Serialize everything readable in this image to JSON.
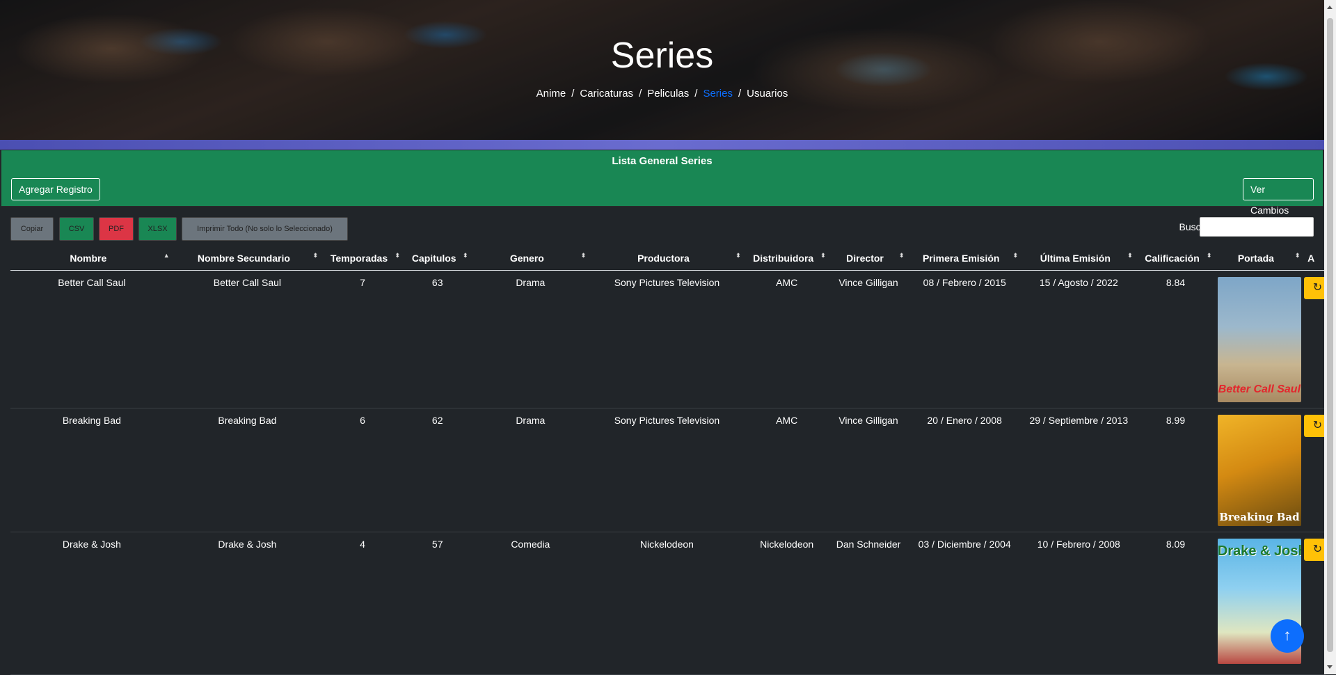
{
  "header": {
    "title": "Series",
    "breadcrumb": [
      {
        "label": "Anime",
        "active": false
      },
      {
        "label": "Caricaturas",
        "active": false
      },
      {
        "label": "Peliculas",
        "active": false
      },
      {
        "label": "Series",
        "active": true
      },
      {
        "label": "Usuarios",
        "active": false
      }
    ],
    "separator": "/"
  },
  "panel": {
    "title": "Lista General Series",
    "add_label": "Agregar Registro",
    "changes_label": "Ver Cambios"
  },
  "export": {
    "copy": "Copiar",
    "csv": "CSV",
    "pdf": "PDF",
    "xlsx": "XLSX",
    "print": "Imprimir Todo (No solo lo Seleccionado)"
  },
  "search": {
    "label": "Buscar:",
    "value": ""
  },
  "table": {
    "columns": [
      "Nombre",
      "Nombre Secundario",
      "Temporadas",
      "Capitulos",
      "Genero",
      "Productora",
      "Distribuidora",
      "Director",
      "Primera Emisión",
      "Última Emisión",
      "Calificación",
      "Portada",
      "A"
    ],
    "rows": [
      {
        "nombre": "Better Call Saul",
        "secundario": "Better Call Saul",
        "temporadas": "7",
        "capitulos": "63",
        "genero": "Drama",
        "productora": "Sony Pictures Television",
        "distribuidora": "AMC",
        "director": "Vince Gilligan",
        "primera": "08 / Febrero / 2015",
        "ultima": "15 / Agosto / 2022",
        "calificacion": "8.84",
        "poster_text": "Better Call Saul"
      },
      {
        "nombre": "Breaking Bad",
        "secundario": "Breaking Bad",
        "temporadas": "6",
        "capitulos": "62",
        "genero": "Drama",
        "productora": "Sony Pictures Television",
        "distribuidora": "AMC",
        "director": "Vince Gilligan",
        "primera": "20 / Enero / 2008",
        "ultima": "29 / Septiembre / 2013",
        "calificacion": "8.99",
        "poster_text": "Breaking Bad"
      },
      {
        "nombre": "Drake & Josh",
        "secundario": "Drake & Josh",
        "temporadas": "4",
        "capitulos": "57",
        "genero": "Comedia",
        "productora": "Nickelodeon",
        "distribuidora": "Nickelodeon",
        "director": "Dan Schneider",
        "primera": "03 / Diciembre / 2004",
        "ultima": "10 / Febrero / 2008",
        "calificacion": "8.09",
        "poster_text": "Drake & Josh"
      }
    ]
  },
  "icons": {
    "sort_asc": "▲",
    "sort_both": "⬍",
    "refresh": "↻",
    "back_to_top": "↑"
  },
  "colors": {
    "panel_green": "#198754",
    "active_link": "#0d6efd",
    "danger": "#dc3545",
    "warning": "#ffc107",
    "secondary": "#6c757d"
  }
}
